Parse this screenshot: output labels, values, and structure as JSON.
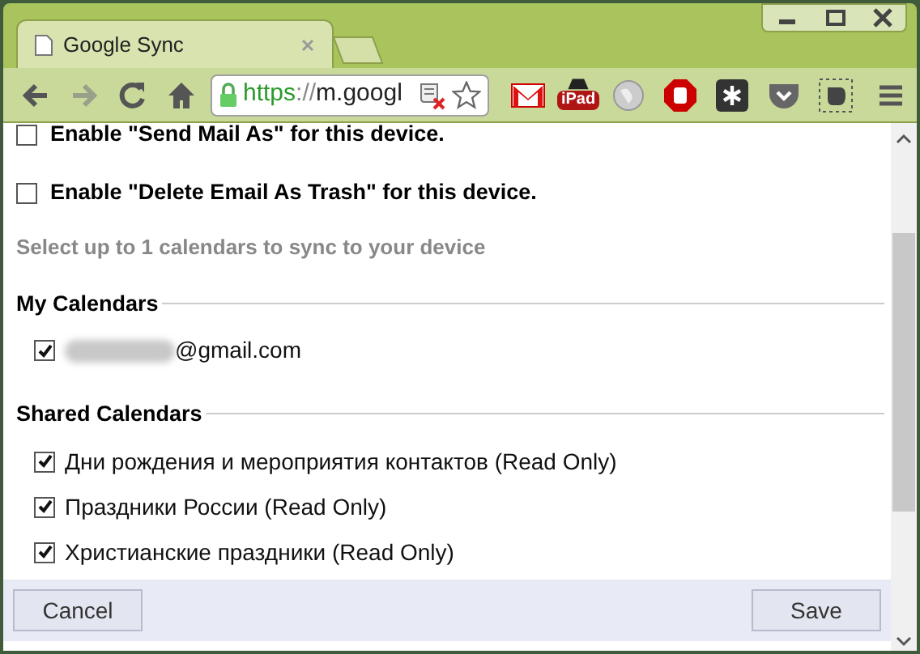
{
  "tabs": [
    {
      "title": "Google Sync",
      "selected": true
    }
  ],
  "nav_buttons": [
    {
      "kind": "back",
      "disabled": false
    },
    {
      "kind": "forward",
      "disabled": true
    },
    {
      "kind": "reload",
      "disabled": false
    },
    {
      "kind": "home",
      "disabled": false
    }
  ],
  "address_bar": {
    "scheme": "https",
    "separator": "://",
    "host": "m.googl",
    "secure": true
  },
  "extensions": [
    {
      "kind": "gmail"
    },
    {
      "kind": "ipad",
      "label": "iPad"
    },
    {
      "kind": "globe"
    },
    {
      "kind": "stop"
    },
    {
      "kind": "asterisk"
    },
    {
      "kind": "pocket"
    },
    {
      "kind": "evernote"
    }
  ],
  "options": [
    {
      "label": "Enable \"Send Mail As\" for this device.",
      "checked": false
    },
    {
      "label": "Enable \"Delete Email As Trash\" for this device.",
      "checked": false
    }
  ],
  "hint": "Select up to 1 calendars to sync to your device",
  "sections": [
    {
      "title": "My Calendars",
      "calendars": [
        {
          "label": "@gmail.com",
          "redacted": true,
          "checked": true
        }
      ]
    },
    {
      "title": "Shared Calendars",
      "calendars": [
        {
          "label": "Дни рождения и мероприятия контактов (Read Only)",
          "redacted": false,
          "checked": true
        },
        {
          "label": "Праздники России (Read Only)",
          "redacted": false,
          "checked": true
        },
        {
          "label": "Христианские праздники (Read Only)",
          "redacted": false,
          "checked": true
        }
      ]
    }
  ],
  "buttons": [
    {
      "label": "Cancel"
    },
    {
      "label": "Save"
    }
  ]
}
